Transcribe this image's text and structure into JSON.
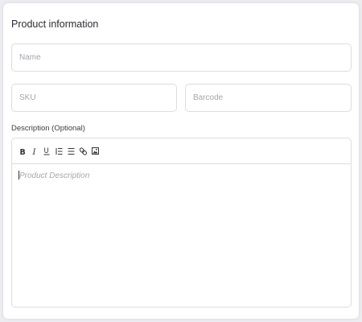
{
  "card": {
    "title": "Product information"
  },
  "fields": {
    "name_placeholder": "Name",
    "sku_placeholder": "SKU",
    "barcode_placeholder": "Barcode"
  },
  "description": {
    "label": "Description (Optional)",
    "placeholder": "Product Description",
    "toolbar": [
      {
        "icon": "bold-icon",
        "glyph": "B"
      },
      {
        "icon": "italic-icon",
        "glyph": "I"
      },
      {
        "icon": "underline-icon",
        "glyph": "U"
      },
      {
        "icon": "ordered-list-icon"
      },
      {
        "icon": "bullet-list-icon"
      },
      {
        "icon": "link-icon"
      },
      {
        "icon": "image-icon"
      }
    ]
  }
}
